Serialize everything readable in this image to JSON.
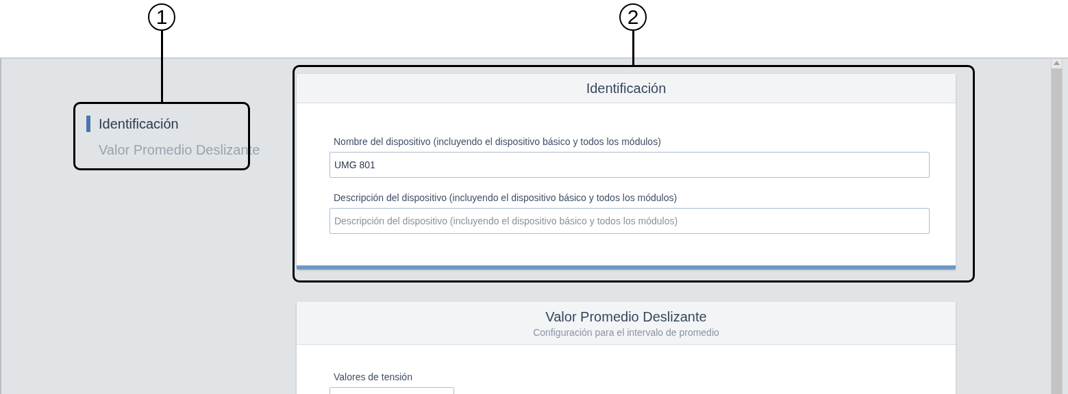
{
  "callouts": [
    {
      "number": "1"
    },
    {
      "number": "2"
    }
  ],
  "sidebar": {
    "items": [
      {
        "label": "Identificación",
        "selected": true
      },
      {
        "label": "Valor Promedio Deslizante",
        "selected": false
      }
    ]
  },
  "cards": [
    {
      "title": "Identificación",
      "fields": [
        {
          "label": "Nombre del dispositivo (incluyendo el dispositivo básico y todos los módulos)",
          "value": "UMG 801",
          "kind": "wide"
        },
        {
          "label": "Descripción del dispositivo (incluyendo el dispositivo básico y todos los módulos)",
          "placeholder": "Descripción del dispositivo (incluyendo el dispositivo básico y todos los módulos)",
          "kind": "wide"
        }
      ]
    },
    {
      "title": "Valor Promedio Deslizante",
      "subtitle": "Configuración para el intervalo de promedio",
      "fields": [
        {
          "label": "Valores de tensión",
          "kind": "narrow"
        }
      ]
    }
  ]
}
